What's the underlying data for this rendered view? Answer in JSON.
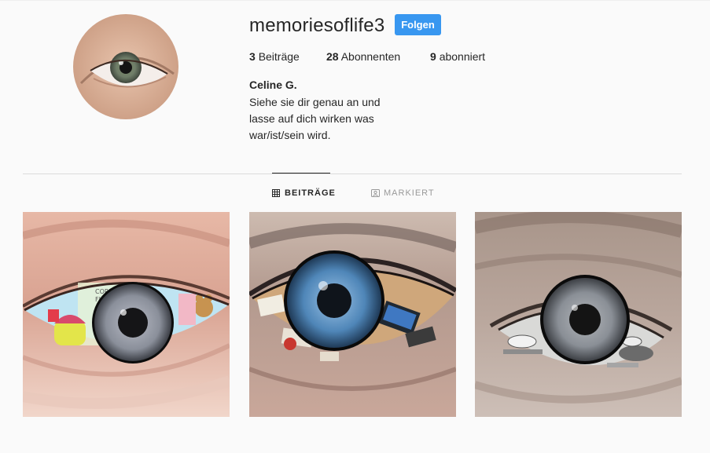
{
  "profile": {
    "username": "memoriesoflife3",
    "follow_label": "Folgen",
    "stats": {
      "posts_count": "3",
      "posts_label": "Beiträge",
      "followers_count": "28",
      "followers_label": "Abonnenten",
      "following_count": "9",
      "following_label": "abonniert"
    },
    "full_name": "Celine G.",
    "bio_lines": [
      "Siehe sie dir genau an und",
      "lasse auf dich wirken was",
      "war/ist/sein wird."
    ]
  },
  "tabs": [
    {
      "label": "BEITRÄGE",
      "icon": "grid-icon",
      "active": true
    },
    {
      "label": "MARKIERT",
      "icon": "tagged-icon",
      "active": false
    }
  ],
  "posts": [
    {
      "subject": "eye-with-childhood-drawing",
      "iris_color": "#8a8f9a"
    },
    {
      "subject": "eye-with-messy-desk",
      "iris_color": "#4f86b8"
    },
    {
      "subject": "eye-with-dining-table",
      "iris_color": "#8a8f96"
    }
  ],
  "colors": {
    "background": "#fafafa",
    "text": "#262626",
    "follow_button": "#3897f0",
    "divider": "#dbdbdb",
    "muted": "#999999"
  }
}
